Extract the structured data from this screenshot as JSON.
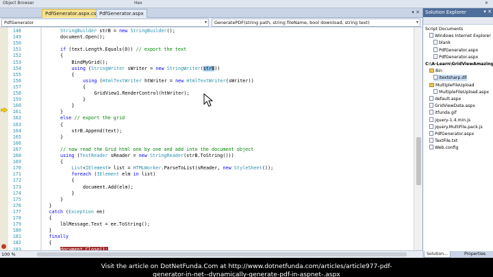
{
  "topbar": {
    "left_label": "Object Browser",
    "hex_label": "Hex"
  },
  "tabs": [
    {
      "label": "PdfGenerator.aspx.cs",
      "active": true
    },
    {
      "label": "PdfGenerator.aspx",
      "active": false
    }
  ],
  "navbar": {
    "class_combo": "PdfGenerator",
    "member_combo": "GeneratePDF(string path, string fileName, bool download, string text)"
  },
  "editor": {
    "lines": [
      {
        "n": "148",
        "indent": 3,
        "tokens": [
          [
            "ty",
            "StringBuilder"
          ],
          [
            "",
            "&nbsp;strB = "
          ],
          [
            "kw",
            "new"
          ],
          [
            "",
            ""
          ],
          [
            "ty",
            "&nbsp;StringBuilder"
          ],
          [
            "",
            "();"
          ]
        ]
      },
      {
        "n": "149",
        "indent": 3,
        "tokens": [
          [
            "",
            "document.Open();"
          ]
        ]
      },
      {
        "n": "150",
        "indent": 0,
        "tokens": []
      },
      {
        "n": "151",
        "indent": 3,
        "tokens": [
          [
            "kw",
            "if"
          ],
          [
            "",
            "&nbsp;(text.Length.Equals(0)) "
          ],
          [
            "cm",
            "// export the text"
          ]
        ]
      },
      {
        "n": "152",
        "indent": 3,
        "tokens": [
          [
            "",
            "{"
          ]
        ]
      },
      {
        "n": "153",
        "indent": 4,
        "tokens": [
          [
            "",
            "BindMyGrid();"
          ]
        ]
      },
      {
        "n": "154",
        "indent": 4,
        "tokens": [
          [
            "kw",
            "using"
          ],
          [
            "",
            "&nbsp;("
          ],
          [
            "ty",
            "StringWriter"
          ],
          [
            "",
            "&nbsp;sWriter = "
          ],
          [
            "kw",
            "new"
          ],
          [
            "ty",
            "&nbsp;StringWriter"
          ],
          [
            "",
            "("
          ],
          [
            "sel",
            "strB"
          ],
          [
            "",
            "))"
          ]
        ]
      },
      {
        "n": "155",
        "indent": 4,
        "tokens": [
          [
            "",
            "{"
          ]
        ]
      },
      {
        "n": "156",
        "indent": 5,
        "tokens": [
          [
            "kw",
            "using"
          ],
          [
            "",
            "&nbsp;("
          ],
          [
            "ty",
            "HtmlTextWriter"
          ],
          [
            "",
            "&nbsp;htWriter = "
          ],
          [
            "kw",
            "new"
          ],
          [
            "ty",
            "&nbsp;HtmlTextWriter"
          ],
          [
            "",
            "(sWriter))"
          ]
        ]
      },
      {
        "n": "157",
        "indent": 5,
        "tokens": [
          [
            "",
            "{"
          ]
        ]
      },
      {
        "n": "158",
        "indent": 6,
        "tokens": [
          [
            "",
            "GridView1.RenderControl(htWriter);"
          ]
        ]
      },
      {
        "n": "159",
        "indent": 5,
        "tokens": [
          [
            "",
            "}"
          ]
        ]
      },
      {
        "n": "160",
        "indent": 4,
        "tokens": [
          [
            "",
            "}"
          ]
        ]
      },
      {
        "n": "161",
        "indent": 3,
        "tokens": [
          [
            "",
            "}"
          ]
        ]
      },
      {
        "n": "162",
        "indent": 3,
        "tokens": [
          [
            "kw",
            "else"
          ],
          [
            "",
            "&nbsp;"
          ],
          [
            "cm",
            "// export the grid"
          ]
        ]
      },
      {
        "n": "163",
        "indent": 3,
        "tokens": [
          [
            "",
            "{"
          ]
        ]
      },
      {
        "n": "164",
        "indent": 4,
        "tokens": [
          [
            "",
            "strB.Append(text);"
          ]
        ]
      },
      {
        "n": "165",
        "indent": 3,
        "tokens": [
          [
            "",
            "}"
          ]
        ]
      },
      {
        "n": "166",
        "indent": 0,
        "tokens": []
      },
      {
        "n": "167",
        "indent": 3,
        "tokens": [
          [
            "cm",
            "// now read the Grid html one by one and add into the document object"
          ]
        ]
      },
      {
        "n": "168",
        "indent": 3,
        "tokens": [
          [
            "kw",
            "using"
          ],
          [
            "",
            "&nbsp;("
          ],
          [
            "ty",
            "TextReader"
          ],
          [
            "",
            "&nbsp;sReader = "
          ],
          [
            "kw",
            "new"
          ],
          [
            "ty",
            "&nbsp;StringReader"
          ],
          [
            "",
            "(strB.ToString()))"
          ]
        ]
      },
      {
        "n": "169",
        "indent": 3,
        "tokens": [
          [
            "",
            "{"
          ]
        ]
      },
      {
        "n": "170",
        "indent": 4,
        "tokens": [
          [
            "ty",
            "List"
          ],
          [
            "",
            "&lt;"
          ],
          [
            "ty",
            "IElement"
          ],
          [
            "",
            "&gt; list = "
          ],
          [
            "ty",
            "HTMLWorker"
          ],
          [
            "",
            ".ParseToList(sReader, "
          ],
          [
            "kw",
            "new"
          ],
          [
            "ty",
            "&nbsp;StyleSheet"
          ],
          [
            "",
            "());"
          ]
        ]
      },
      {
        "n": "171",
        "indent": 4,
        "tokens": [
          [
            "kw",
            "foreach"
          ],
          [
            "",
            "&nbsp;("
          ],
          [
            "ty",
            "IElement"
          ],
          [
            "",
            "&nbsp;elm "
          ],
          [
            "kw",
            "in"
          ],
          [
            "",
            "&nbsp;list)"
          ]
        ]
      },
      {
        "n": "172",
        "indent": 4,
        "tokens": [
          [
            "",
            "{"
          ]
        ]
      },
      {
        "n": "173",
        "indent": 5,
        "tokens": [
          [
            "",
            "document.Add(elm);"
          ]
        ]
      },
      {
        "n": "174",
        "indent": 4,
        "tokens": [
          [
            "",
            "}"
          ]
        ]
      },
      {
        "n": "175",
        "indent": 3,
        "tokens": [
          [
            "",
            "}"
          ]
        ]
      },
      {
        "n": "176",
        "indent": 2,
        "tokens": [
          [
            "",
            "}"
          ]
        ]
      },
      {
        "n": "177",
        "indent": 2,
        "tokens": [
          [
            "kw",
            "catch"
          ],
          [
            "",
            "&nbsp;("
          ],
          [
            "ty",
            "Exception"
          ],
          [
            "",
            "&nbsp;ee)"
          ]
        ]
      },
      {
        "n": "178",
        "indent": 2,
        "tokens": [
          [
            "",
            "{"
          ]
        ]
      },
      {
        "n": "179",
        "indent": 3,
        "tokens": [
          [
            "",
            "lblMessage.Text = ee.ToString();"
          ]
        ]
      },
      {
        "n": "180",
        "indent": 2,
        "tokens": [
          [
            "",
            "}"
          ]
        ]
      },
      {
        "n": "181",
        "indent": 2,
        "tokens": [
          [
            "kw",
            "finally"
          ]
        ]
      },
      {
        "n": "182",
        "indent": 2,
        "tokens": [
          [
            "",
            "{"
          ]
        ]
      },
      {
        "n": "183",
        "indent": 3,
        "tokens": [
          [
            "bp",
            "document.Close();"
          ]
        ]
      }
    ]
  },
  "zoom": "100 %",
  "solution_explorer": {
    "title": "Solution Explorer",
    "items": [
      {
        "label": "Script Documents",
        "depth": 0,
        "kind": "text"
      },
      {
        "label": "Windows Internet Explorer",
        "depth": 1,
        "kind": "file"
      },
      {
        "label": "blank",
        "depth": 2,
        "kind": "file"
      },
      {
        "label": "PdfGenerator.aspx",
        "depth": 2,
        "kind": "file"
      },
      {
        "label": "PdfGenerator.aspx",
        "depth": 2,
        "kind": "file"
      },
      {
        "label": "C:\\A-Learn\\GridViewAmazing\\",
        "depth": 0,
        "kind": "bold"
      },
      {
        "label": "Bin",
        "depth": 1,
        "kind": "folder"
      },
      {
        "label": "itextsharp.dll",
        "depth": 2,
        "kind": "file",
        "selected": true
      },
      {
        "label": "MultipleFileUpload",
        "depth": 1,
        "kind": "folder"
      },
      {
        "label": "MultipleFileUpload.aspx",
        "depth": 2,
        "kind": "file"
      },
      {
        "label": "default.aspx",
        "depth": 1,
        "kind": "file"
      },
      {
        "label": "GridViewData.aspx",
        "depth": 1,
        "kind": "file"
      },
      {
        "label": "itfunda.gif",
        "depth": 1,
        "kind": "file"
      },
      {
        "label": "jquery-1.4.min.js",
        "depth": 1,
        "kind": "file"
      },
      {
        "label": "jquery.MultiFile.pack.js",
        "depth": 1,
        "kind": "file"
      },
      {
        "label": "PdfGenerator.aspx",
        "depth": 1,
        "kind": "file"
      },
      {
        "label": "TextFile.txt",
        "depth": 1,
        "kind": "file"
      },
      {
        "label": "Web.config",
        "depth": 1,
        "kind": "file"
      }
    ],
    "tab_solution": "Solution...",
    "tab_properties": "Properties"
  },
  "caption": {
    "line1": "Visit the article on DotNetFunda.Com at http://www.dotnetfunda.com/articles/article977-pdf-",
    "line2": "generator-in-net--dynamically-generate-pdf-in-aspnet-.aspx"
  }
}
